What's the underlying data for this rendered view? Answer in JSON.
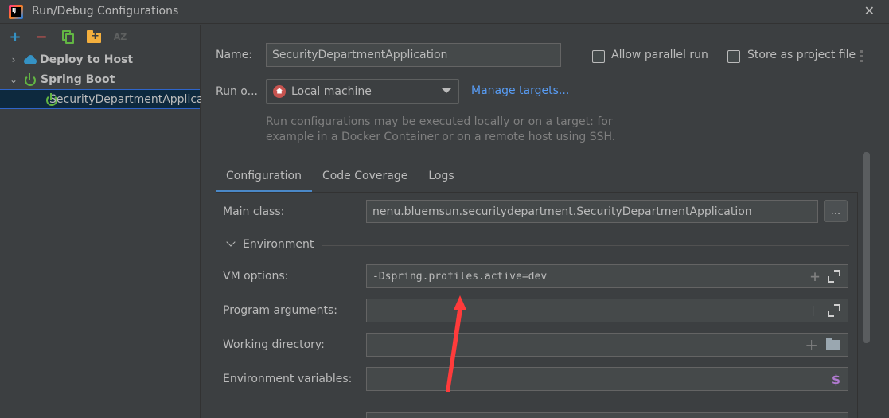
{
  "window": {
    "title": "Run/Debug Configurations",
    "close_glyph": "✕"
  },
  "toolbar": {
    "add": "+",
    "remove": "−",
    "sort": "AZ"
  },
  "tree": {
    "items": [
      {
        "label": "Deploy to Host",
        "chev": "›"
      },
      {
        "label": "Spring Boot",
        "chev": "⌄"
      },
      {
        "label": "SecurityDepartmentApplication"
      }
    ]
  },
  "form": {
    "name_label": "Name:",
    "name_value": "SecurityDepartmentApplication",
    "allow_parallel_label": "Allow parallel run",
    "store_label": "Store as project file",
    "run_on_label": "Run o...",
    "run_on_value": "Local machine",
    "manage_targets": "Manage targets...",
    "hint_line1": "Run configurations may be executed locally or on a target: for",
    "hint_line2": "example in a Docker Container or on a remote host using SSH."
  },
  "tabs": [
    {
      "label": "Configuration",
      "active": true
    },
    {
      "label": "Code Coverage",
      "active": false
    },
    {
      "label": "Logs",
      "active": false
    }
  ],
  "config": {
    "main_class_label": "Main class:",
    "main_class_value": "nenu.bluemsun.securitydepartment.SecurityDepartmentApplication",
    "browse_button": "...",
    "environment_label": "Environment",
    "vm_options_label": "VM options:",
    "vm_options_value": "-Dspring.profiles.active=dev",
    "program_args_label": "Program arguments:",
    "working_dir_label": "Working directory:",
    "env_vars_label": "Environment variables:",
    "plus_glyph": "+",
    "dollar_glyph": "$"
  },
  "colors": {
    "background": "#3c3f41",
    "field_bg": "#45494a",
    "selection": "#0d293e",
    "link": "#589df6",
    "accent_tab": "#4a88c7",
    "arrow": "#ff3b3b"
  },
  "icons": {
    "app": "intellij-icon",
    "add": "plus-icon",
    "remove": "minus-icon",
    "copy": "copy-icon",
    "folder": "new-folder-icon",
    "sort": "sort-az-icon",
    "deploy": "cloud-upload-icon",
    "spring": "power-icon",
    "local_machine": "home-icon",
    "expand": "expand-icon",
    "browse_folder": "folder-icon",
    "env_vars": "dollar-icon"
  }
}
